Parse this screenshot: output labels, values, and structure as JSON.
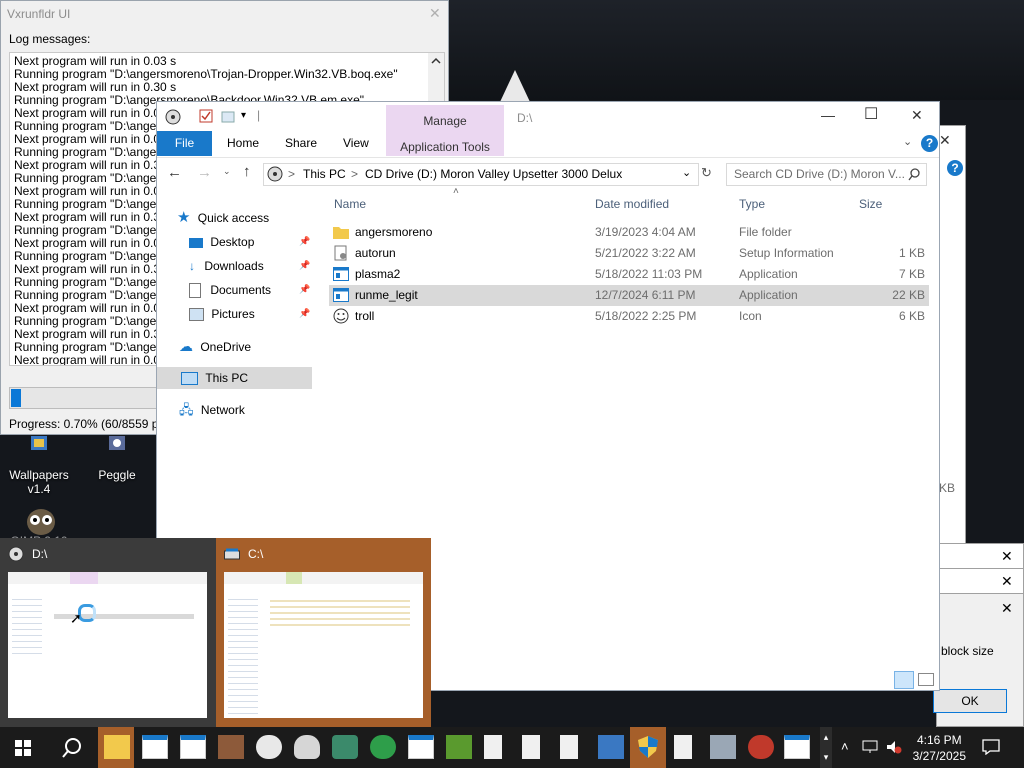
{
  "desktop": {
    "icons": [
      {
        "label": "Wallpapers v1.4"
      },
      {
        "label": "Peggle"
      },
      {
        "label": "GIMP 2.10"
      }
    ]
  },
  "vxrunfldr": {
    "title": "Vxrunfldr UI",
    "log_label": "Log messages:",
    "log_lines": [
      "Next program will run in 0.03 s",
      "Running program \"D:\\angersmoreno\\Trojan-Dropper.Win32.VB.boq.exe\"",
      "Next program will run in 0.30 s",
      "Running program \"D:\\angersmoreno\\Backdoor.Win32.VB.em.exe\"",
      "Next program will run in 0.07 s",
      "Running program \"D:\\angersm",
      "Next program will run in 0.07 s",
      "Running program \"D:\\angersm",
      "Next program will run in 0.30 s",
      "Running program \"D:\\angersm",
      "Next program will run in 0.03 s",
      "Running program \"D:\\angersm",
      "Next program will run in 0.30 s",
      "Running program \"D:\\angersm",
      "Next program will run in 0.03 s",
      "Running program \"D:\\angersm",
      "Next program will run in 0.30 s",
      "Running program \"D:\\angersm",
      "Running program \"D:\\angersm",
      "Next program will run in 0.03 s",
      "Running program \"D:\\angersm",
      "Next program will run in 0.33 s",
      "Running program \"D:\\angersm",
      "Next program will run in 0.03 s"
    ],
    "progress_text": "Progress: 0.70% (60/8559 prog",
    "progress_fraction": 0.007
  },
  "explorer": {
    "qat_separator": "|",
    "manage_label": "Manage",
    "app_tools_label": "Application Tools",
    "window_title": "D:\\",
    "tabs": {
      "file": "File",
      "home": "Home",
      "share": "Share",
      "view": "View"
    },
    "help": "?",
    "address": {
      "this_pc": "This PC",
      "sep": ">",
      "drive": "CD Drive (D:) Moron Valley Upsetter 3000 Delux"
    },
    "search_placeholder": "Search CD Drive (D:) Moron V...",
    "nav": {
      "quick_access": "Quick access",
      "desktop": "Desktop",
      "downloads": "Downloads",
      "documents": "Documents",
      "pictures": "Pictures",
      "onedrive": "OneDrive",
      "this_pc": "This PC",
      "network": "Network"
    },
    "columns": {
      "name": "Name",
      "date": "Date modified",
      "type": "Type",
      "size": "Size"
    },
    "files": [
      {
        "name": "angersmoreno",
        "date": "3/19/2023 4:04 AM",
        "type": "File folder",
        "size": "",
        "icon": "folder-icon"
      },
      {
        "name": "autorun",
        "date": "5/21/2022 3:22 AM",
        "type": "Setup Information",
        "size": "1 KB",
        "icon": "setup-file-icon"
      },
      {
        "name": "plasma2",
        "date": "5/18/2022 11:03 PM",
        "type": "Application",
        "size": "7 KB",
        "icon": "application-icon"
      },
      {
        "name": "runme_legit",
        "date": "12/7/2024 6:11 PM",
        "type": "Application",
        "size": "22 KB",
        "icon": "application-icon"
      },
      {
        "name": "troll",
        "date": "5/18/2022 2:25 PM",
        "type": "Icon",
        "size": "6 KB",
        "icon": "troll-icon"
      }
    ]
  },
  "background": {
    "kb_fragment": "KB",
    "block_size_text": "block size",
    "ok_label": "OK",
    "close_glyph": "✕"
  },
  "thumbnails": [
    {
      "title": "D:\\"
    },
    {
      "title": "C:\\"
    }
  ],
  "taskbar": {
    "time": "4:16 PM",
    "date": "3/27/2025"
  },
  "colors": {
    "accent": "#1979ca",
    "manage": "#ebd7f1",
    "thumb_active": "#a65f2a"
  }
}
